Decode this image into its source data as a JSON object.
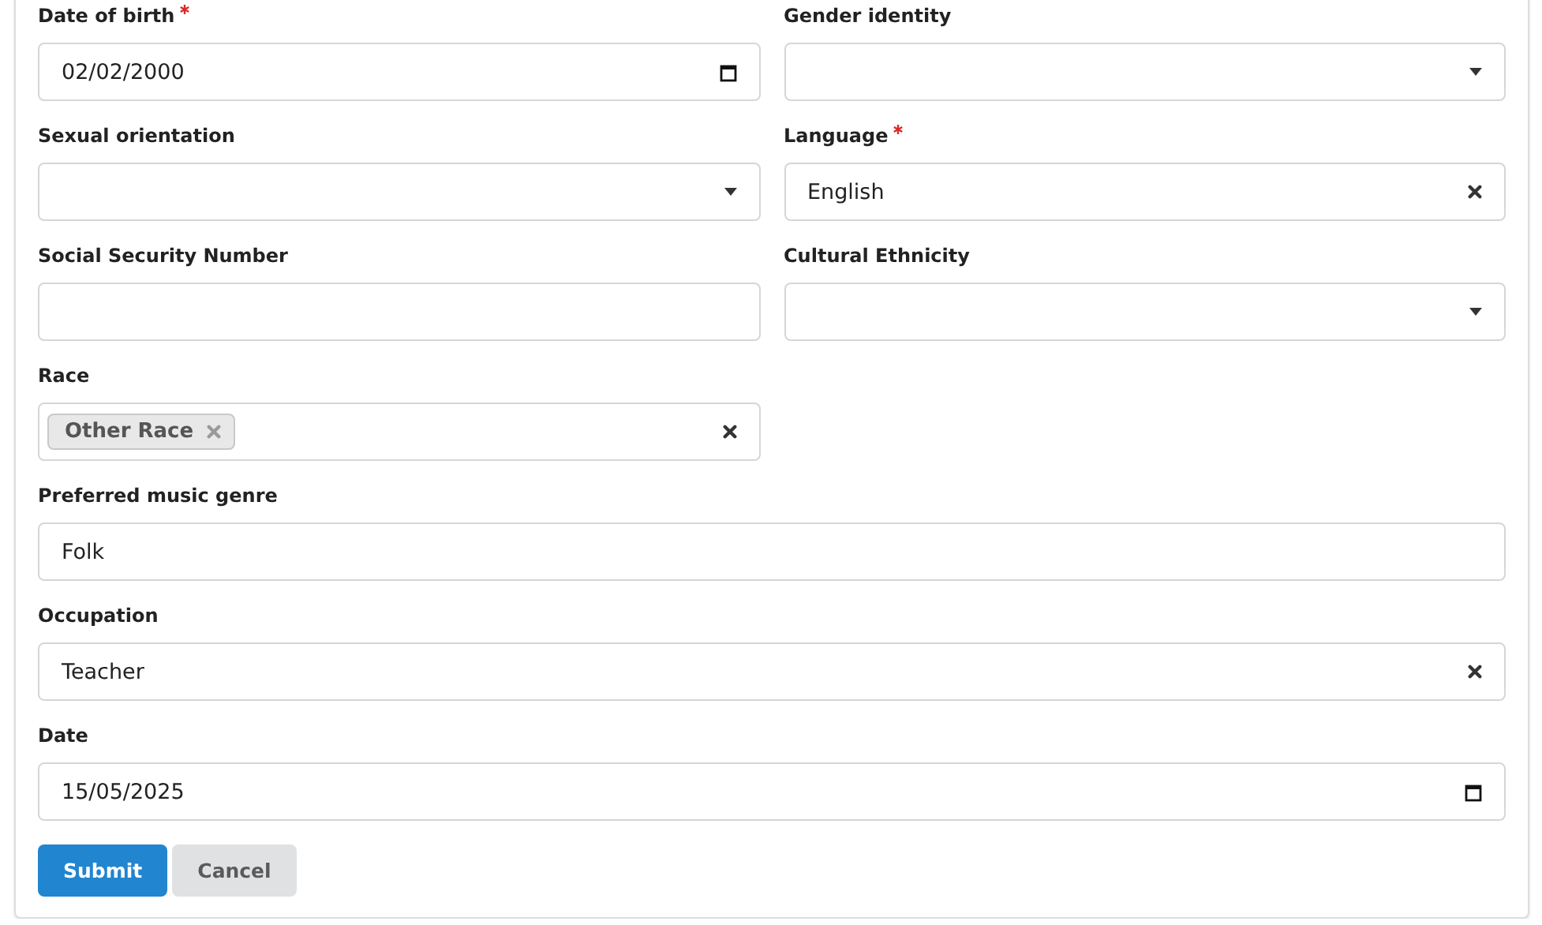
{
  "two_column_fields": [
    {
      "label": "Date of birth",
      "required": true,
      "kind": "date",
      "value": "02/02/2000"
    },
    {
      "label": "Gender identity",
      "required": false,
      "kind": "select"
    },
    {
      "label": "Sexual orientation",
      "required": false,
      "kind": "select"
    },
    {
      "label": "Language",
      "required": true,
      "kind": "clearable",
      "value": "English"
    },
    {
      "label": "Social Security Number",
      "required": false,
      "kind": "text"
    },
    {
      "label": "Cultural Ethnicity",
      "required": false,
      "kind": "select"
    },
    {
      "label": "Race",
      "required": false,
      "kind": "multiselect",
      "tags": [
        "Other Race"
      ]
    }
  ],
  "full_width_fields": [
    {
      "label": "Preferred music genre",
      "required": false,
      "kind": "text",
      "value": "Folk"
    },
    {
      "label": "Occupation",
      "required": false,
      "kind": "clearable",
      "value": "Teacher"
    },
    {
      "label": "Date",
      "required": false,
      "kind": "date",
      "value": "15/05/2025"
    }
  ],
  "buttons": [
    {
      "label": "Submit",
      "kind": "primary"
    },
    {
      "label": "Cancel",
      "kind": "secondary"
    }
  ]
}
